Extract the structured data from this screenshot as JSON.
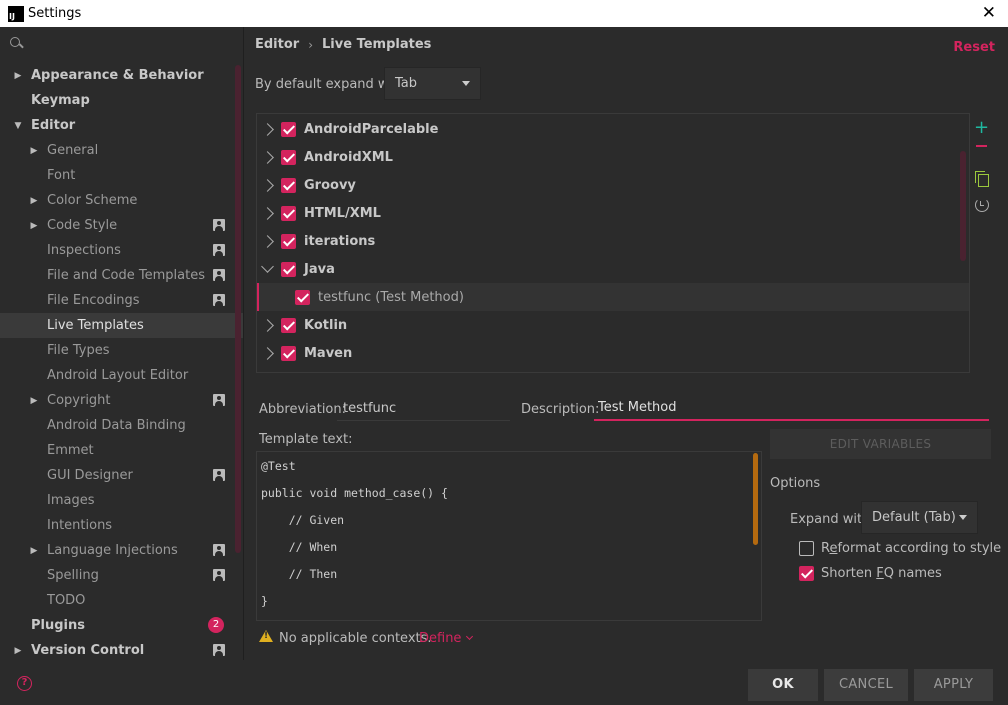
{
  "window": {
    "title": "Settings",
    "app_icon": "IJ",
    "close_glyph": "✕"
  },
  "sidebar": {
    "search_placeholder": "",
    "items": [
      {
        "label": "Appearance & Behavior",
        "top": true,
        "arrow": "▶"
      },
      {
        "label": "Keymap",
        "top": true,
        "arrow": ""
      },
      {
        "label": "Editor",
        "top": true,
        "arrow": "▼"
      },
      {
        "label": "General",
        "arrow": "▶"
      },
      {
        "label": "Font",
        "arrow": ""
      },
      {
        "label": "Color Scheme",
        "arrow": "▶"
      },
      {
        "label": "Code Style",
        "arrow": "▶",
        "icon": "project-settings-icon"
      },
      {
        "label": "Inspections",
        "arrow": "",
        "icon": "project-settings-icon"
      },
      {
        "label": "File and Code Templates",
        "arrow": "",
        "icon": "project-settings-icon"
      },
      {
        "label": "File Encodings",
        "arrow": "",
        "icon": "project-settings-icon"
      },
      {
        "label": "Live Templates",
        "arrow": "",
        "selected": true
      },
      {
        "label": "File Types",
        "arrow": ""
      },
      {
        "label": "Android Layout Editor",
        "arrow": ""
      },
      {
        "label": "Copyright",
        "arrow": "▶",
        "icon": "project-settings-icon"
      },
      {
        "label": "Android Data Binding",
        "arrow": ""
      },
      {
        "label": "Emmet",
        "arrow": ""
      },
      {
        "label": "GUI Designer",
        "arrow": "",
        "icon": "project-settings-icon"
      },
      {
        "label": "Images",
        "arrow": ""
      },
      {
        "label": "Intentions",
        "arrow": ""
      },
      {
        "label": "Language Injections",
        "arrow": "▶",
        "icon": "project-settings-icon"
      },
      {
        "label": "Spelling",
        "arrow": "",
        "icon": "project-settings-icon"
      },
      {
        "label": "TODO",
        "arrow": ""
      },
      {
        "label": "Plugins",
        "top": true,
        "arrow": "",
        "badge": "2"
      },
      {
        "label": "Version Control",
        "top": true,
        "arrow": "▶",
        "icon": "project-settings-icon"
      }
    ]
  },
  "breadcrumb": {
    "parent": "Editor",
    "separator": "›",
    "current": "Live Templates"
  },
  "reset_label": "Reset",
  "expand_default": {
    "label": "By default expand with",
    "value": "Tab"
  },
  "template_groups": [
    {
      "name": "AndroidParcelable",
      "expanded": false,
      "checked": true
    },
    {
      "name": "AndroidXML",
      "expanded": false,
      "checked": true
    },
    {
      "name": "Groovy",
      "expanded": false,
      "checked": true
    },
    {
      "name": "HTML/XML",
      "expanded": false,
      "checked": true
    },
    {
      "name": "iterations",
      "expanded": false,
      "checked": true
    },
    {
      "name": "Java",
      "expanded": true,
      "checked": true
    },
    {
      "name": "testfunc (Test Method)",
      "child": true,
      "checked": true
    },
    {
      "name": "Kotlin",
      "expanded": false,
      "checked": true
    },
    {
      "name": "Maven",
      "expanded": false,
      "checked": true
    }
  ],
  "toolbar": {
    "add_glyph": "+"
  },
  "editor": {
    "abbreviation_label": "Abbreviation:",
    "abbreviation_value": "testfunc",
    "description_label": "Description:",
    "description_value": "Test Method",
    "template_text_label": "Template text:",
    "code_lines": [
      "@Test",
      "public void method_case() {",
      "    // Given",
      "    // When",
      "    // Then",
      "}"
    ]
  },
  "contexts": {
    "warning_text": "No applicable contexts.",
    "define_label": "Define"
  },
  "options": {
    "edit_variables_label": "EDIT VARIABLES",
    "title": "Options",
    "expand_with_label": "Expand with",
    "expand_with_value": "Default (Tab)",
    "reformat_pre": "R",
    "reformat_u": "e",
    "reformat_post": "format according to style",
    "reformat_checked": false,
    "shorten_pre": "Shorten ",
    "shorten_u": "F",
    "shorten_post": "Q names",
    "shorten_checked": true
  },
  "buttons": {
    "ok": "OK",
    "cancel": "CANCEL",
    "apply": "APPLY",
    "help_glyph": "?"
  },
  "colors": {
    "accent": "#d3245e",
    "background": "#2b2b2b",
    "add": "#1fb8a0",
    "copy": "#9bc83d",
    "scroll_code": "#b46a10"
  }
}
